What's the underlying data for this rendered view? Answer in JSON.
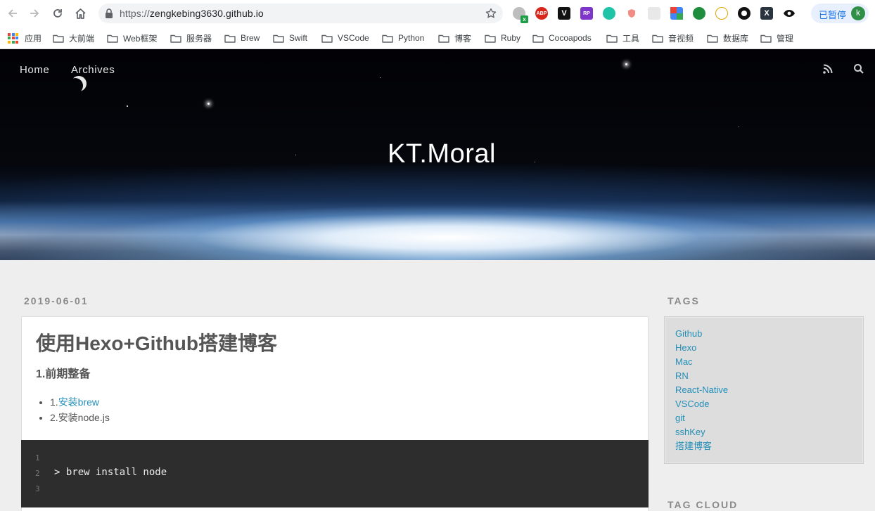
{
  "browser": {
    "url_prefix": "https://",
    "url_host": "zengkebing3630.github.io",
    "profile_label": "已暂停",
    "profile_initial": "k",
    "extensions": [
      {
        "name": "extension-x-icon"
      },
      {
        "name": "adblock-plus-icon",
        "label": "ABP"
      },
      {
        "name": "vimium-icon",
        "label": "V"
      },
      {
        "name": "rp-icon",
        "label": "RP"
      },
      {
        "name": "teal-circle-icon"
      },
      {
        "name": "shield-icon"
      },
      {
        "name": "grid-extension-icon"
      },
      {
        "name": "google-translate-icon"
      },
      {
        "name": "green-search-icon"
      },
      {
        "name": "tree-icon"
      },
      {
        "name": "circle-icon"
      },
      {
        "name": "x-box-icon",
        "label": "X"
      },
      {
        "name": "eye-icon"
      }
    ]
  },
  "bookmarks": {
    "apps_label": "应用",
    "folders": [
      "大前端",
      "Web框架",
      "服务器",
      "Brew",
      "Swift",
      "VSCode",
      "Python",
      "博客",
      "Ruby",
      "Cocoapods",
      "工具",
      "音视频",
      "数据库",
      "管理"
    ]
  },
  "site": {
    "nav": {
      "home": "Home",
      "archives": "Archives"
    },
    "title": "KT.Moral"
  },
  "post": {
    "date": "2019-06-01",
    "title": "使用Hexo+Github搭建博客",
    "section_heading": "1.前期整备",
    "items": [
      {
        "prefix": "1.",
        "link_text": "安装brew"
      },
      {
        "prefix": "2.",
        "text": "安装node.js"
      }
    ],
    "code": [
      {
        "line": "1",
        "text": ""
      },
      {
        "line": "2",
        "text": "> brew install node"
      },
      {
        "line": "3",
        "text": ""
      }
    ]
  },
  "sidebar": {
    "tags_heading": "TAGS",
    "tags": [
      "Github",
      "Hexo",
      "Mac",
      "RN",
      "React-Native",
      "VSCode",
      "git",
      "sshKey",
      "搭建博客"
    ],
    "tag_cloud_heading": "TAG CLOUD"
  },
  "colors": {
    "link": "#258fb8",
    "page_bg": "#eeeeee",
    "code_bg": "#2d2d2d"
  }
}
